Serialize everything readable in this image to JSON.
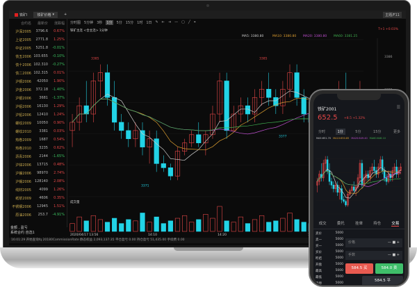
{
  "desktop": {
    "tabs": [
      {
        "label": "铁矿I"
      },
      {
        "label": "铁矿价格"
      },
      {
        "label": "+"
      }
    ],
    "right_button": "主题/F11",
    "watchlist": {
      "headers": [
        "合约名",
        "最新价",
        "涨跌幅"
      ],
      "rows": [
        {
          "name": "沪深2005",
          "price": "3796.6",
          "change": "0.67%",
          "dir": "up"
        },
        {
          "name": "上证2005",
          "price": "2771.8",
          "change": "1.25%",
          "dir": "up"
        },
        {
          "name": "中证2005",
          "price": "5251.8",
          "change": "-0.01%",
          "dir": "dn"
        },
        {
          "name": "债五2006",
          "price": "103.655",
          "change": "-0.10%",
          "dir": "dn"
        },
        {
          "name": "债十2006",
          "price": "102.310",
          "change": "-0.27%",
          "dir": "dn"
        },
        {
          "name": "债二2006",
          "price": "102.315",
          "change": "0.01%",
          "dir": "up"
        },
        {
          "name": "沪铜2006",
          "price": "42050",
          "change": "1.90%",
          "dir": "up"
        },
        {
          "name": "沪金2006",
          "price": "372.18",
          "change": "-1.40%",
          "dir": "dn"
        },
        {
          "name": "沪银2006",
          "price": "3681",
          "change": "-1.37%",
          "dir": "dn"
        },
        {
          "name": "沪铝2006",
          "price": "16130",
          "change": "1.29%",
          "dir": "up"
        },
        {
          "name": "沪铅2006",
          "price": "12410",
          "change": "1.24%",
          "dir": "up"
        },
        {
          "name": "螺纹2009",
          "price": "10050",
          "change": "0.90%",
          "dir": "up"
        },
        {
          "name": "螺纹2010",
          "price": "3381",
          "change": "0.03%",
          "dir": "up"
        },
        {
          "name": "热卷2009",
          "price": "1687",
          "change": "0.54%",
          "dir": "up"
        },
        {
          "name": "热卷2010",
          "price": "3235",
          "change": "0.62%",
          "dir": "up"
        },
        {
          "name": "沥青2006",
          "price": "2144",
          "change": "-1.65%",
          "dir": "dn"
        },
        {
          "name": "沪锌2006",
          "price": "13715",
          "change": "0.48%",
          "dir": "up"
        },
        {
          "name": "沪镍2006",
          "price": "98970",
          "change": "2.74%",
          "dir": "up"
        },
        {
          "name": "沪锡2006",
          "price": "128140",
          "change": "2.08%",
          "dir": "up"
        },
        {
          "name": "线材2005",
          "price": "4099",
          "change": "1.26%",
          "dir": "up"
        },
        {
          "name": "纸浆2009",
          "price": "4606",
          "change": "0.35%",
          "dir": "up"
        },
        {
          "name": "不锈钢2006",
          "price": "12945",
          "change": "1.51%",
          "dir": "up"
        },
        {
          "name": "原油2006",
          "price": "253.7",
          "change": "-4.91%",
          "dir": "dn"
        }
      ],
      "footer": [
        "金额",
        "盈亏",
        "系统合约",
        "自选1"
      ]
    },
    "toolbar": {
      "periods": [
        "分时图",
        "5分钟",
        "3秒",
        "1分",
        "5分",
        "15分",
        "1时",
        "1日"
      ],
      "selected": "1分"
    },
    "chart_title": "铁矿主连 <合主连> 1分钟",
    "ma_legend": [
      {
        "label": "MA5: 3380.80",
        "color": "#cccccc"
      },
      {
        "label": "MA10: 3380.80",
        "color": "#e0a030"
      },
      {
        "label": "MA20: 3380.80",
        "color": "#c050d0"
      },
      {
        "label": "MA60: 3381.25",
        "color": "#40b050"
      }
    ],
    "change_label": "T+1 +0.03%",
    "volume_label": "成交量",
    "time_labels": [
      "2020/04/17 13:56",
      "14:10",
      "14:20",
      "14:30"
    ],
    "price_labels": [
      "3385",
      "3385",
      "3371",
      "3377"
    ],
    "status_text": "16:01:29 开始查询fq 20180CommissionRate  静态权益 2,093,137.35  平仓盈亏 0.00  持仓盈亏 51,435.00  手续费 0.00"
  },
  "mobile": {
    "title": "铁矿2001",
    "price": "652.5",
    "change": "+8.5  +1.32%",
    "tabs": [
      "分时",
      "1分",
      "5分",
      "15分",
      "更多"
    ],
    "selected_tab": "1分",
    "ma_legend": [
      "MA5:651.70",
      "MA10:650.85",
      "MA20:649.40",
      "MA60:648.10"
    ],
    "bottom_tabs": [
      "成交",
      "委托",
      "挂单",
      "持仓",
      "交易"
    ],
    "selected_bottom_tab": "交易",
    "book": [
      {
        "k": "卖价",
        "v": "5000"
      },
      {
        "k": "卖一",
        "v": "5000"
      },
      {
        "k": "买一",
        "v": "5000"
      },
      {
        "k": "买价",
        "v": "5000"
      },
      {
        "k": "昨结",
        "v": "5000"
      },
      {
        "k": "开盘",
        "v": "5000"
      },
      {
        "k": "最高",
        "v": "5000"
      },
      {
        "k": "最低",
        "v": "5000"
      },
      {
        "k": "涨停",
        "v": "5000"
      }
    ],
    "price_field": "价格",
    "qty_field": "手数",
    "buy_button": "584.5 买",
    "sell_button": "584.0 卖",
    "close_button": "584.5 平"
  },
  "colors": {
    "up": "#e84848",
    "down": "#22d3e6",
    "background": "#0b0b0b"
  },
  "chart_data": {
    "type": "candlestick",
    "ohlc": [
      [
        3377,
        3379,
        3375,
        3378
      ],
      [
        3378,
        3381,
        3377,
        3380
      ],
      [
        3380,
        3383,
        3378,
        3379
      ],
      [
        3379,
        3384,
        3378,
        3383
      ],
      [
        3383,
        3385,
        3381,
        3384
      ],
      [
        3384,
        3385,
        3380,
        3381
      ],
      [
        3381,
        3383,
        3377,
        3378
      ],
      [
        3378,
        3379,
        3376,
        3377
      ],
      [
        3377,
        3378,
        3375,
        3376
      ],
      [
        3376,
        3378,
        3375,
        3377
      ],
      [
        3377,
        3378,
        3374,
        3375
      ],
      [
        3375,
        3377,
        3373,
        3376
      ],
      [
        3376,
        3377,
        3372,
        3373
      ],
      [
        3373,
        3374,
        3372,
        3372.5
      ],
      [
        3372.5,
        3373,
        3371,
        3371.5
      ],
      [
        3371.5,
        3375,
        3371,
        3374.5
      ],
      [
        3374.5,
        3376,
        3374,
        3375.5
      ],
      [
        3375.5,
        3377,
        3375,
        3376.5
      ],
      [
        3376.5,
        3378,
        3375,
        3375.5
      ],
      [
        3375.5,
        3377,
        3374,
        3376.5
      ],
      [
        3376.5,
        3380,
        3376,
        3379
      ],
      [
        3379,
        3384,
        3378,
        3383
      ],
      [
        3383,
        3384,
        3376,
        3377
      ],
      [
        3377,
        3380,
        3377,
        3379
      ],
      [
        3379,
        3381,
        3378,
        3380
      ],
      [
        3380,
        3381,
        3378,
        3379
      ],
      [
        3379,
        3382,
        3378,
        3381
      ],
      [
        3381,
        3383,
        3380,
        3382
      ],
      [
        3382,
        3384,
        3380,
        3381
      ],
      [
        3381,
        3382,
        3379,
        3380
      ],
      [
        3380,
        3383,
        3379,
        3382
      ],
      [
        3382,
        3385,
        3381,
        3384
      ],
      [
        3384,
        3385,
        3380,
        3381
      ],
      [
        3381,
        3382,
        3378,
        3379
      ],
      [
        3379,
        3380,
        3377,
        3378
      ],
      [
        3378,
        3381,
        3377.5,
        3380
      ],
      [
        3380,
        3381,
        3378,
        3379
      ],
      [
        3379,
        3382,
        3378,
        3381
      ],
      [
        3381,
        3383,
        3380,
        3382
      ],
      [
        3382,
        3384,
        3379,
        3380
      ],
      [
        3380,
        3382,
        3379,
        3381
      ],
      [
        3381,
        3383,
        3380,
        3382
      ]
    ],
    "volume": [
      30,
      55,
      40,
      60,
      45,
      35,
      50,
      30,
      45,
      40,
      70,
      35,
      55,
      30,
      40,
      50,
      60,
      35,
      45,
      65,
      50,
      95,
      40,
      35,
      55,
      30,
      45,
      60,
      35,
      40,
      50,
      70,
      45,
      35,
      30,
      50,
      40,
      55,
      30,
      45,
      35,
      40
    ],
    "ylim": [
      3369,
      3388
    ],
    "y_ticks": [
      "3386",
      "3382",
      "3378",
      "3374"
    ]
  }
}
